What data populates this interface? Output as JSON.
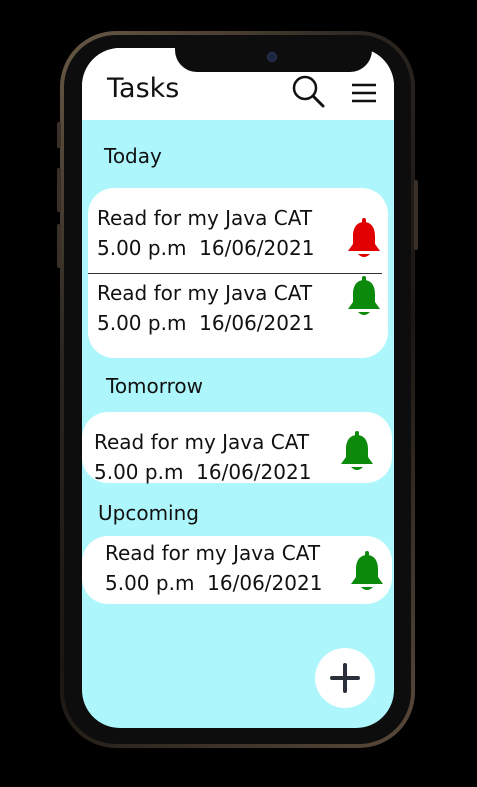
{
  "header": {
    "title": "Tasks"
  },
  "sections": [
    {
      "label": "Today",
      "tasks": [
        {
          "title": "Read for my Java CAT",
          "time": "5.00 p.m",
          "date": "16/06/2021",
          "bell_color": "#e00000",
          "bell": "bell-icon"
        },
        {
          "title": "Read for my Java CAT",
          "time": "5.00 p.m",
          "date": "16/06/2021",
          "bell_color": "#0b8a0b",
          "bell": "bell-icon"
        }
      ]
    },
    {
      "label": "Tomorrow",
      "tasks": [
        {
          "title": "Read for my Java CAT",
          "time": "5.00 p.m",
          "date": "16/06/2021",
          "bell_color": "#0b8a0b",
          "bell": "bell-icon"
        }
      ]
    },
    {
      "label": "Upcoming",
      "tasks": [
        {
          "title": "Read for my Java CAT",
          "time": "5.00 p.m",
          "date": "16/06/2021",
          "bell_color": "#0b8a0b",
          "bell": "bell-icon"
        }
      ]
    }
  ],
  "colors": {
    "background": "#adf6fb",
    "card": "#ffffff",
    "alert": "#e00000",
    "normal": "#0b8a0b"
  },
  "icons": {
    "search": "search-icon",
    "menu": "menu-icon",
    "add": "add-icon"
  }
}
